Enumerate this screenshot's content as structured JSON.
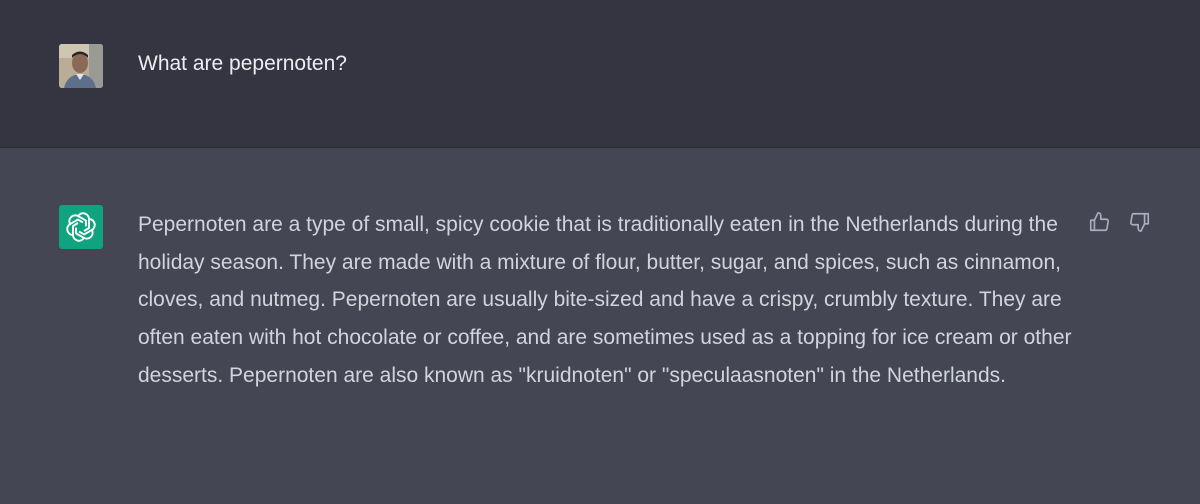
{
  "conversation": {
    "user_message": {
      "avatar_icon": "user-photo-avatar",
      "text": "What are pepernoten?"
    },
    "assistant_message": {
      "avatar_icon": "openai-logo-icon",
      "avatar_color": "#10a37f",
      "text": "Pepernoten are a type of small, spicy cookie that is traditionally eaten in the Netherlands during the holiday season. They are made with a mixture of flour, butter, sugar, and spices, such as cinnamon, cloves, and nutmeg. Pepernoten are usually bite-sized and have a crispy, crumbly texture. They are often eaten with hot chocolate or coffee, and are sometimes used as a topping for ice cream or other desserts. Pepernoten are also known as \"kruidnoten\" or \"speculaasnoten\" in the Netherlands.",
      "feedback_icons": [
        "thumbs-up-icon",
        "thumbs-down-icon"
      ]
    }
  },
  "colors": {
    "user_row_bg": "#343541",
    "assistant_row_bg": "#444654",
    "user_text": "#ececf1",
    "assistant_text": "#d1d5db",
    "icon_color": "#acacbe"
  }
}
